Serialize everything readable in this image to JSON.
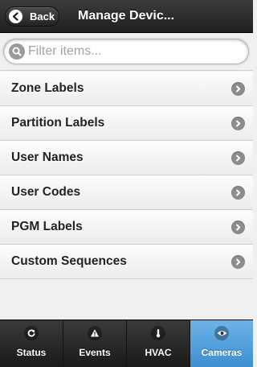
{
  "header": {
    "back_label": "Back",
    "title": "Manage Devic..."
  },
  "search": {
    "placeholder": "Filter items...",
    "value": ""
  },
  "list": {
    "items": [
      {
        "label": "Zone Labels"
      },
      {
        "label": "Partition Labels"
      },
      {
        "label": "User Names"
      },
      {
        "label": "User Codes"
      },
      {
        "label": "PGM Labels"
      },
      {
        "label": "Custom Sequences"
      }
    ]
  },
  "tabbar": {
    "tabs": [
      {
        "label": "Status",
        "icon": "refresh-icon"
      },
      {
        "label": "Events",
        "icon": "alert-icon"
      },
      {
        "label": "HVAC",
        "icon": "thermometer-icon"
      },
      {
        "label": "Cameras",
        "icon": "eye-icon"
      }
    ],
    "active": "Cameras"
  },
  "colors": {
    "header_bg": "#2b2b2b",
    "tab_active": "#4f9fde",
    "chevron": "#8c8c8c"
  }
}
